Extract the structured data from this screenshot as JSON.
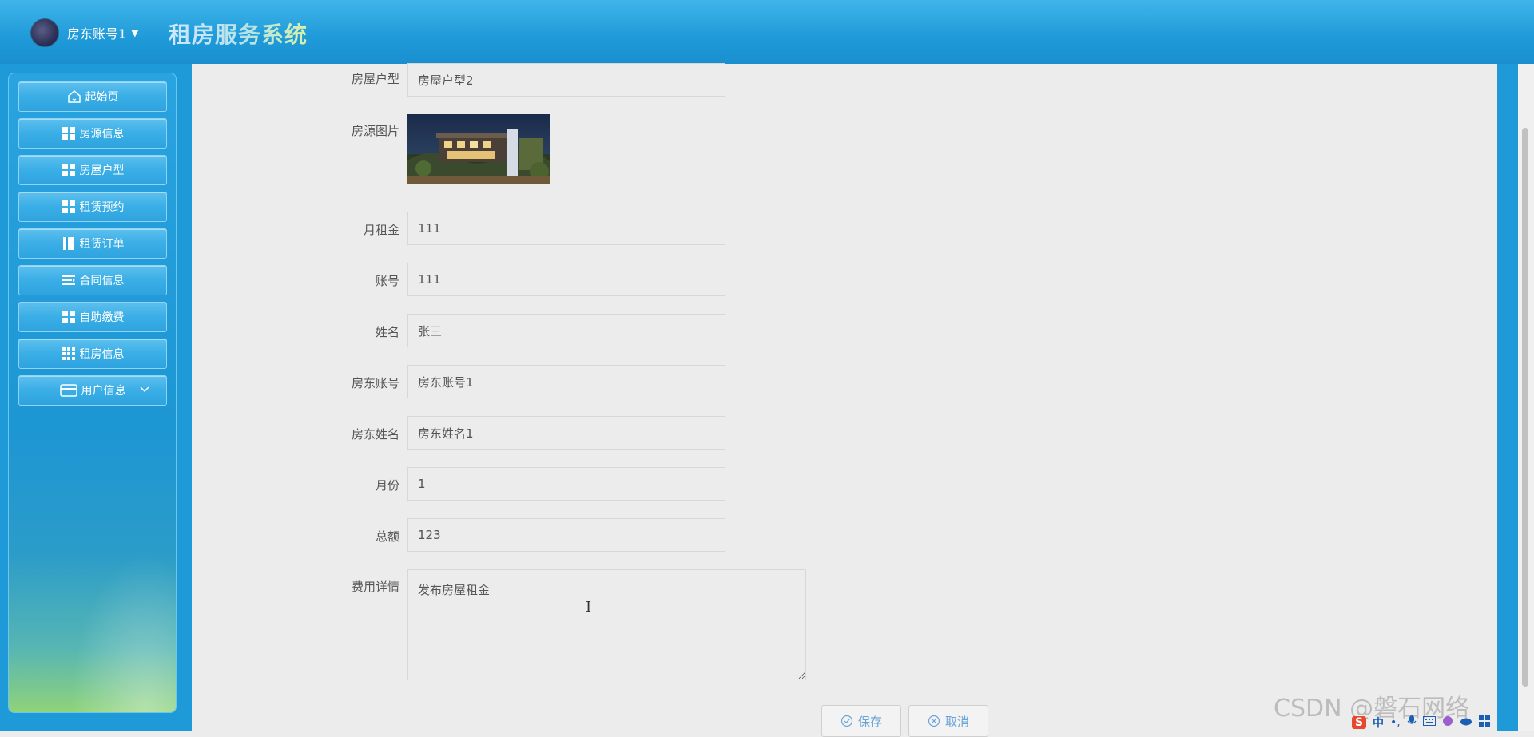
{
  "header": {
    "user_name": "房东账号1",
    "app_title": "租房服务系统",
    "caret": "▼"
  },
  "sidebar": {
    "items": [
      {
        "label": "起始页",
        "icon": "home-icon"
      },
      {
        "label": "房源信息",
        "icon": "grid-icon"
      },
      {
        "label": "房屋户型",
        "icon": "grid-icon"
      },
      {
        "label": "租赁预约",
        "icon": "grid-icon"
      },
      {
        "label": "租赁订单",
        "icon": "book-icon"
      },
      {
        "label": "合同信息",
        "icon": "list-icon"
      },
      {
        "label": "自助缴费",
        "icon": "grid-icon"
      },
      {
        "label": "租房信息",
        "icon": "grid9-icon"
      },
      {
        "label": "用户信息",
        "icon": "card-icon"
      }
    ]
  },
  "form": {
    "house_type": {
      "label": "房屋户型",
      "value": "房屋户型2"
    },
    "house_image": {
      "label": "房源图片"
    },
    "monthly_rent": {
      "label": "月租金",
      "value": "111"
    },
    "account": {
      "label": "账号",
      "value": "111"
    },
    "name": {
      "label": "姓名",
      "value": "张三"
    },
    "landlord_account": {
      "label": "房东账号",
      "value": "房东账号1"
    },
    "landlord_name": {
      "label": "房东姓名",
      "value": "房东姓名1"
    },
    "month": {
      "label": "月份",
      "value": "1"
    },
    "total": {
      "label": "总额",
      "value": "123"
    },
    "fee_details": {
      "label": "费用详情",
      "value": "发布房屋租金"
    }
  },
  "actions": {
    "save_label": "保存",
    "cancel_label": "取消"
  },
  "watermark": "CSDN @磐石网络",
  "ime": {
    "logo": "S",
    "mode": "中"
  },
  "colors": {
    "header_blue": "#1f9ad8",
    "button_text": "#6aa3d8",
    "content_bg": "#ececec"
  }
}
